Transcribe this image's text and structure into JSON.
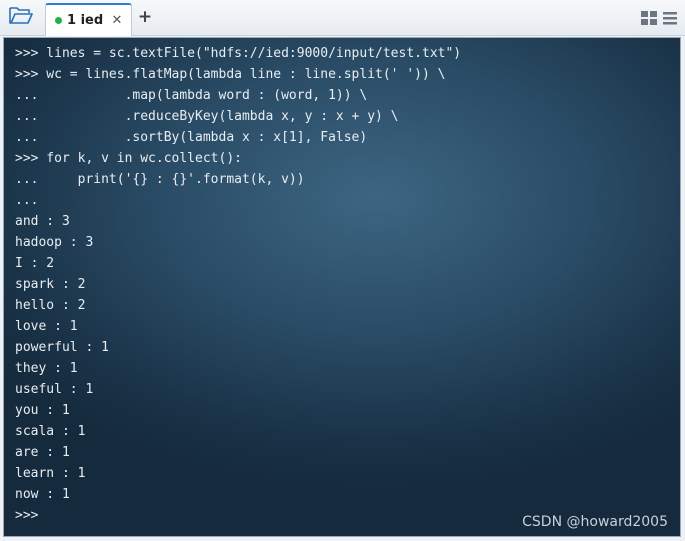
{
  "tabbar": {
    "tab_label": "1 ied",
    "tab_close": "✕",
    "add_tab": "+"
  },
  "colors": {
    "active_dot": "#22b14c",
    "terminal_bg": "#2a4c66",
    "terminal_text": "#e8edf2"
  },
  "icons": [
    "folder-open-icon",
    "close-icon",
    "plus-icon",
    "layout-grid-icon",
    "menu-icon"
  ],
  "terminal": {
    "lines": [
      ">>> lines = sc.textFile(\"hdfs://ied:9000/input/test.txt\")",
      ">>> wc = lines.flatMap(lambda line : line.split(' ')) \\",
      "...           .map(lambda word : (word, 1)) \\",
      "...           .reduceByKey(lambda x, y : x + y) \\",
      "...           .sortBy(lambda x : x[1], False)",
      ">>> for k, v in wc.collect():",
      "...     print('{} : {}'.format(k, v))",
      "...",
      "and : 3",
      "hadoop : 3",
      "I : 2",
      "spark : 2",
      "hello : 2",
      "love : 1",
      "powerful : 1",
      "they : 1",
      "useful : 1",
      "you : 1",
      "scala : 1",
      "are : 1",
      "learn : 1",
      "now : 1",
      ">>>"
    ]
  },
  "watermark": "CSDN @howard2005"
}
